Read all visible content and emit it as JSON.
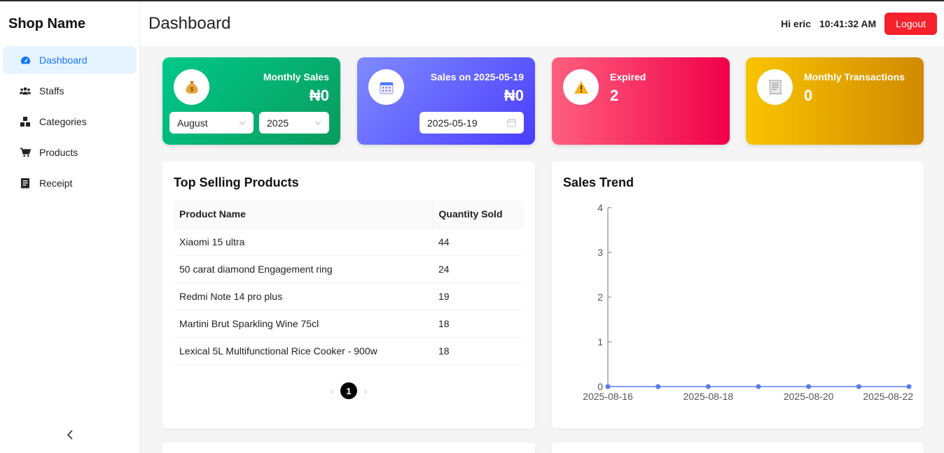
{
  "sidebar": {
    "brand": "Shop Name",
    "items": [
      {
        "label": "Dashboard",
        "icon": "dashboard-icon",
        "active": true
      },
      {
        "label": "Staffs",
        "icon": "users-icon"
      },
      {
        "label": "Categories",
        "icon": "categories-icon"
      },
      {
        "label": "Products",
        "icon": "cart-icon"
      },
      {
        "label": "Receipt",
        "icon": "receipt-icon"
      }
    ],
    "collapse": "<"
  },
  "header": {
    "title": "Dashboard",
    "greeting": "Hi eric",
    "time": "10:41:32 AM",
    "logout": "Logout"
  },
  "cards": {
    "monthly_sales": {
      "label": "Monthly Sales",
      "value": "₦0",
      "month": "August",
      "year": "2025",
      "icon": "money-bag-icon"
    },
    "daily_sales": {
      "label": "Sales on 2025-05-19",
      "value": "₦0",
      "date": "2025-05-19",
      "icon": "calendar-icon"
    },
    "expired": {
      "label": "Expired",
      "value": "2",
      "icon": "warning-icon"
    },
    "monthly_transactions": {
      "label": "Monthly Transactions",
      "value": "0",
      "icon": "receipt-icon"
    }
  },
  "colors": {
    "accent": "#1677ff",
    "logout": "#f5222d",
    "chart_line": "#5b7be8"
  },
  "top_selling": {
    "title": "Top Selling Products",
    "columns": [
      "Product Name",
      "Quantity Sold"
    ],
    "rows": [
      [
        "Xiaomi 15 ultra",
        "44"
      ],
      [
        "50 carat diamond Engagement ring",
        "24"
      ],
      [
        "Redmi Note 14 pro plus",
        "19"
      ],
      [
        "Martini Brut Sparkling Wine 75cl",
        "18"
      ],
      [
        "Lexical 5L Multifunctional Rice Cooker - 900w",
        "18"
      ]
    ],
    "page": "1",
    "prev": "‹",
    "next": "›"
  },
  "sales_trend": {
    "title": "Sales Trend"
  },
  "chart_data": {
    "type": "line",
    "x": [
      "2025-08-16",
      "2025-08-17",
      "2025-08-18",
      "2025-08-19",
      "2025-08-20",
      "2025-08-21",
      "2025-08-22"
    ],
    "x_tick_labels": [
      "2025-08-16",
      "2025-08-18",
      "2025-08-20",
      "2025-08-22"
    ],
    "series": [
      {
        "values": [
          0,
          0,
          0,
          0,
          0,
          0,
          0
        ]
      }
    ],
    "ylim": [
      0,
      4
    ],
    "y_ticks": [
      0,
      1,
      2,
      3,
      4
    ],
    "grid": false
  }
}
